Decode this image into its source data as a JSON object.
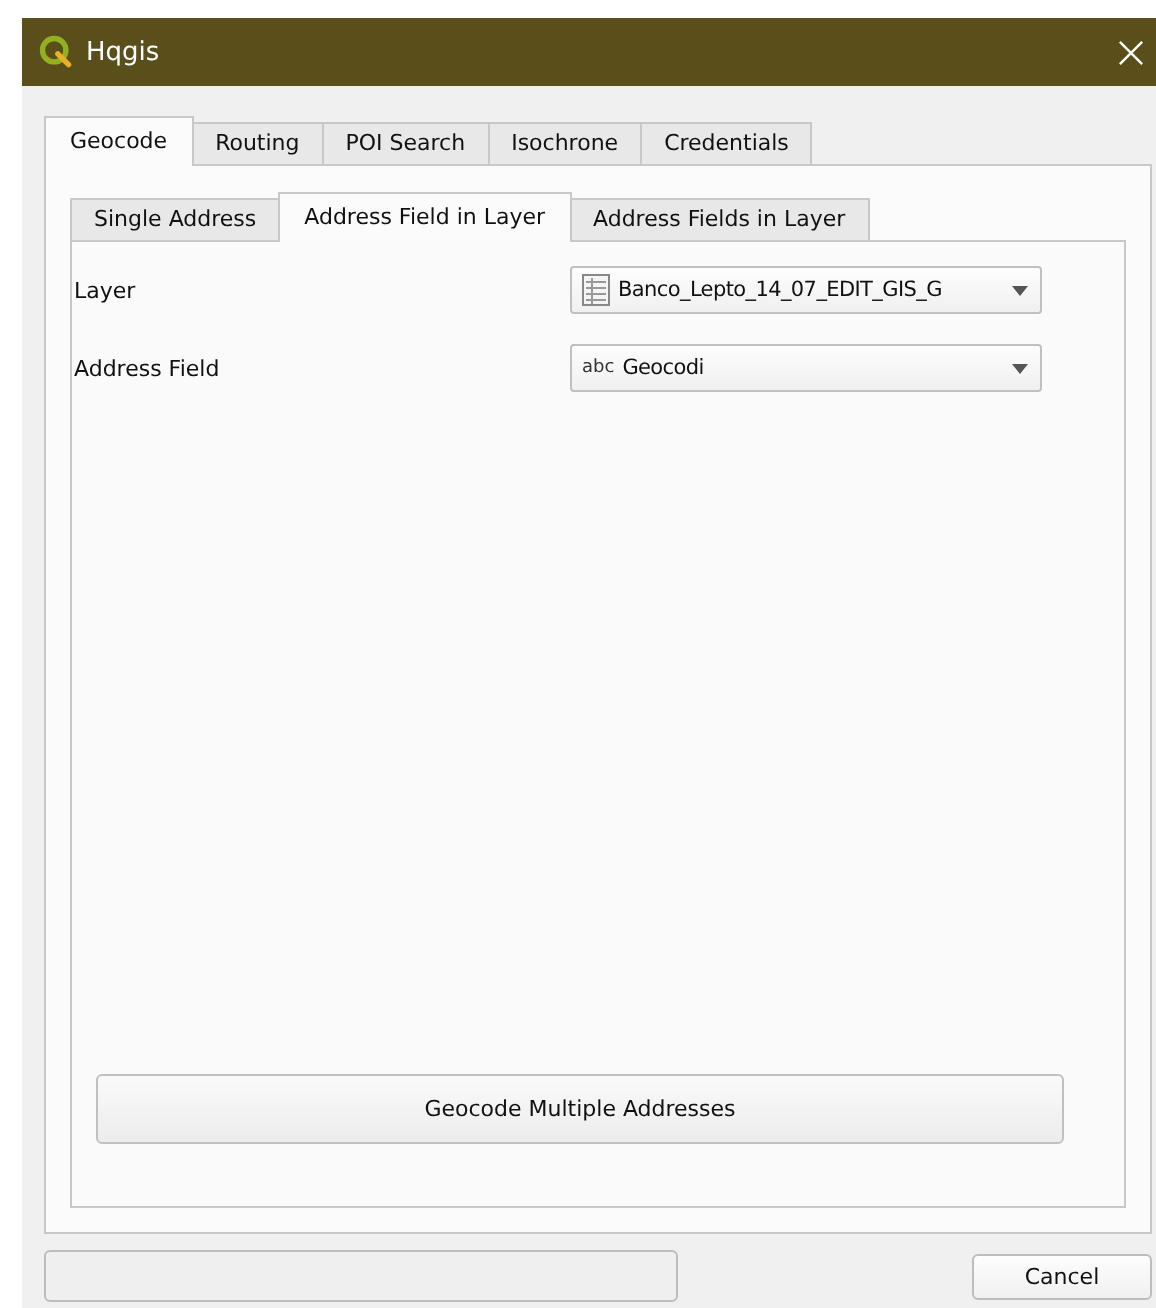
{
  "window": {
    "title": "Hqgis"
  },
  "tabs": [
    {
      "label": "Geocode",
      "selected": true
    },
    {
      "label": "Routing",
      "selected": false
    },
    {
      "label": "POI Search",
      "selected": false
    },
    {
      "label": "Isochrone",
      "selected": false
    },
    {
      "label": "Credentials",
      "selected": false
    }
  ],
  "subtabs": [
    {
      "label": "Single Address",
      "selected": false
    },
    {
      "label": "Address Field in Layer",
      "selected": true
    },
    {
      "label": "Address Fields in Layer",
      "selected": false
    }
  ],
  "fields": [
    {
      "label": "Layer",
      "value": "Banco_Lepto_14_07_EDIT_GIS_G",
      "kind": "layer"
    },
    {
      "label": "Address Field",
      "value": "Geocodi",
      "kind": "text",
      "type_badge": "abc"
    }
  ],
  "action_button": "Geocode Multiple Addresses",
  "buttons": [
    "Cancel"
  ]
}
